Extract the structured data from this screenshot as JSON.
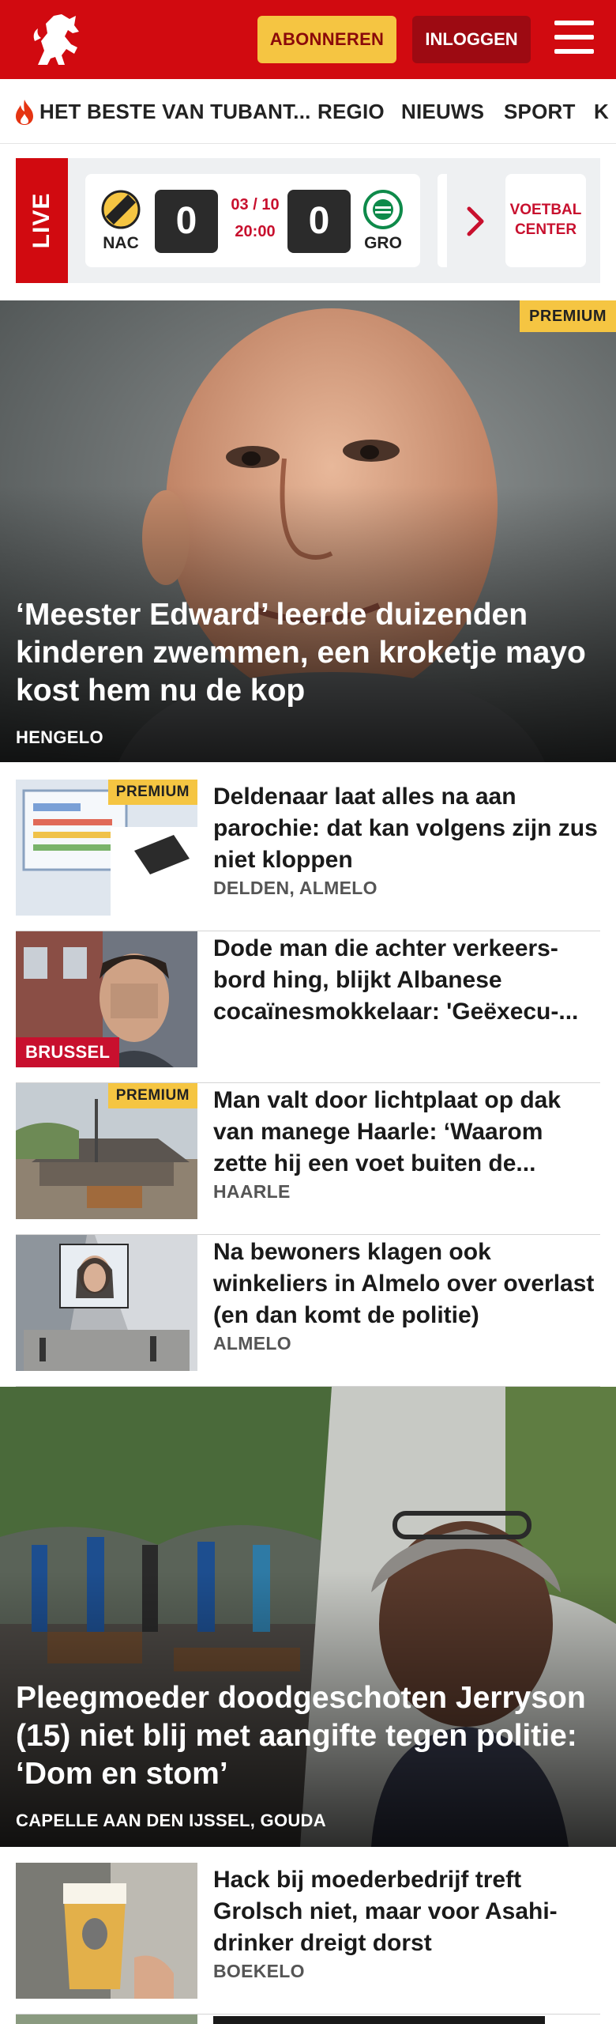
{
  "header": {
    "subscribe_label": "ABONNEREN",
    "login_label": "INLOGGEN",
    "logo_icon": "tubantia-horse-logo-icon",
    "menu_icon": "hamburger-menu-icon",
    "brand_color": "#d10a10"
  },
  "nav": {
    "items": [
      {
        "label": "HET BESTE VAN TUBANT..."
      },
      {
        "label": "REGIO"
      },
      {
        "label": "NIEUWS"
      },
      {
        "label": "SPORT"
      },
      {
        "label": "K"
      }
    ]
  },
  "live": {
    "label": "LIVE",
    "match": {
      "home_code": "NAC",
      "home_score": "0",
      "date": "03 / 10",
      "time": "20:00",
      "away_score": "0",
      "away_code": "GRO"
    },
    "center_label": "VOETBAL CENTER"
  },
  "hero": {
    "badge": "PREMIUM",
    "title": "‘Meester Edward’ leerde duizenden kinderen zwemmen, een kroketje mayo kost hem nu de kop",
    "location": "HENGELO"
  },
  "articles": [
    {
      "title": "Deldenaar laat alles na aan parochie: dat kan volgens zijn zus niet kloppen",
      "location": "DELDEN, ALMELO",
      "badge": "PREMIUM"
    },
    {
      "title": "Dode man die achter verkeers­bord hing, blijkt Albanese cocaïnesmokkelaar: 'Geëxecu-...",
      "tag": "BRUSSEL"
    },
    {
      "title": "Man valt door lichtplaat op dak van manege Haarle: ‘Waarom zette hij een voet buiten de...",
      "location": "HAARLE",
      "badge": "PREMIUM"
    },
    {
      "title": "Na bewoners klagen ook winkeliers in Almelo over overlast (en dan komt de politie)",
      "location": "ALMELO"
    }
  ],
  "hero2": {
    "title": "Pleegmoeder doodgeschoten Jerryson (15) niet blij met aangifte tegen politie: ‘Dom en stom’",
    "location": "CAPELLE AAN DEN IJSSEL, GOUDA"
  },
  "articles2": [
    {
      "title": "Hack bij moederbedrijf treft Grolsch niet, maar voor Asahi-drinker dreigt dorst",
      "location": "BOEKELO"
    }
  ]
}
